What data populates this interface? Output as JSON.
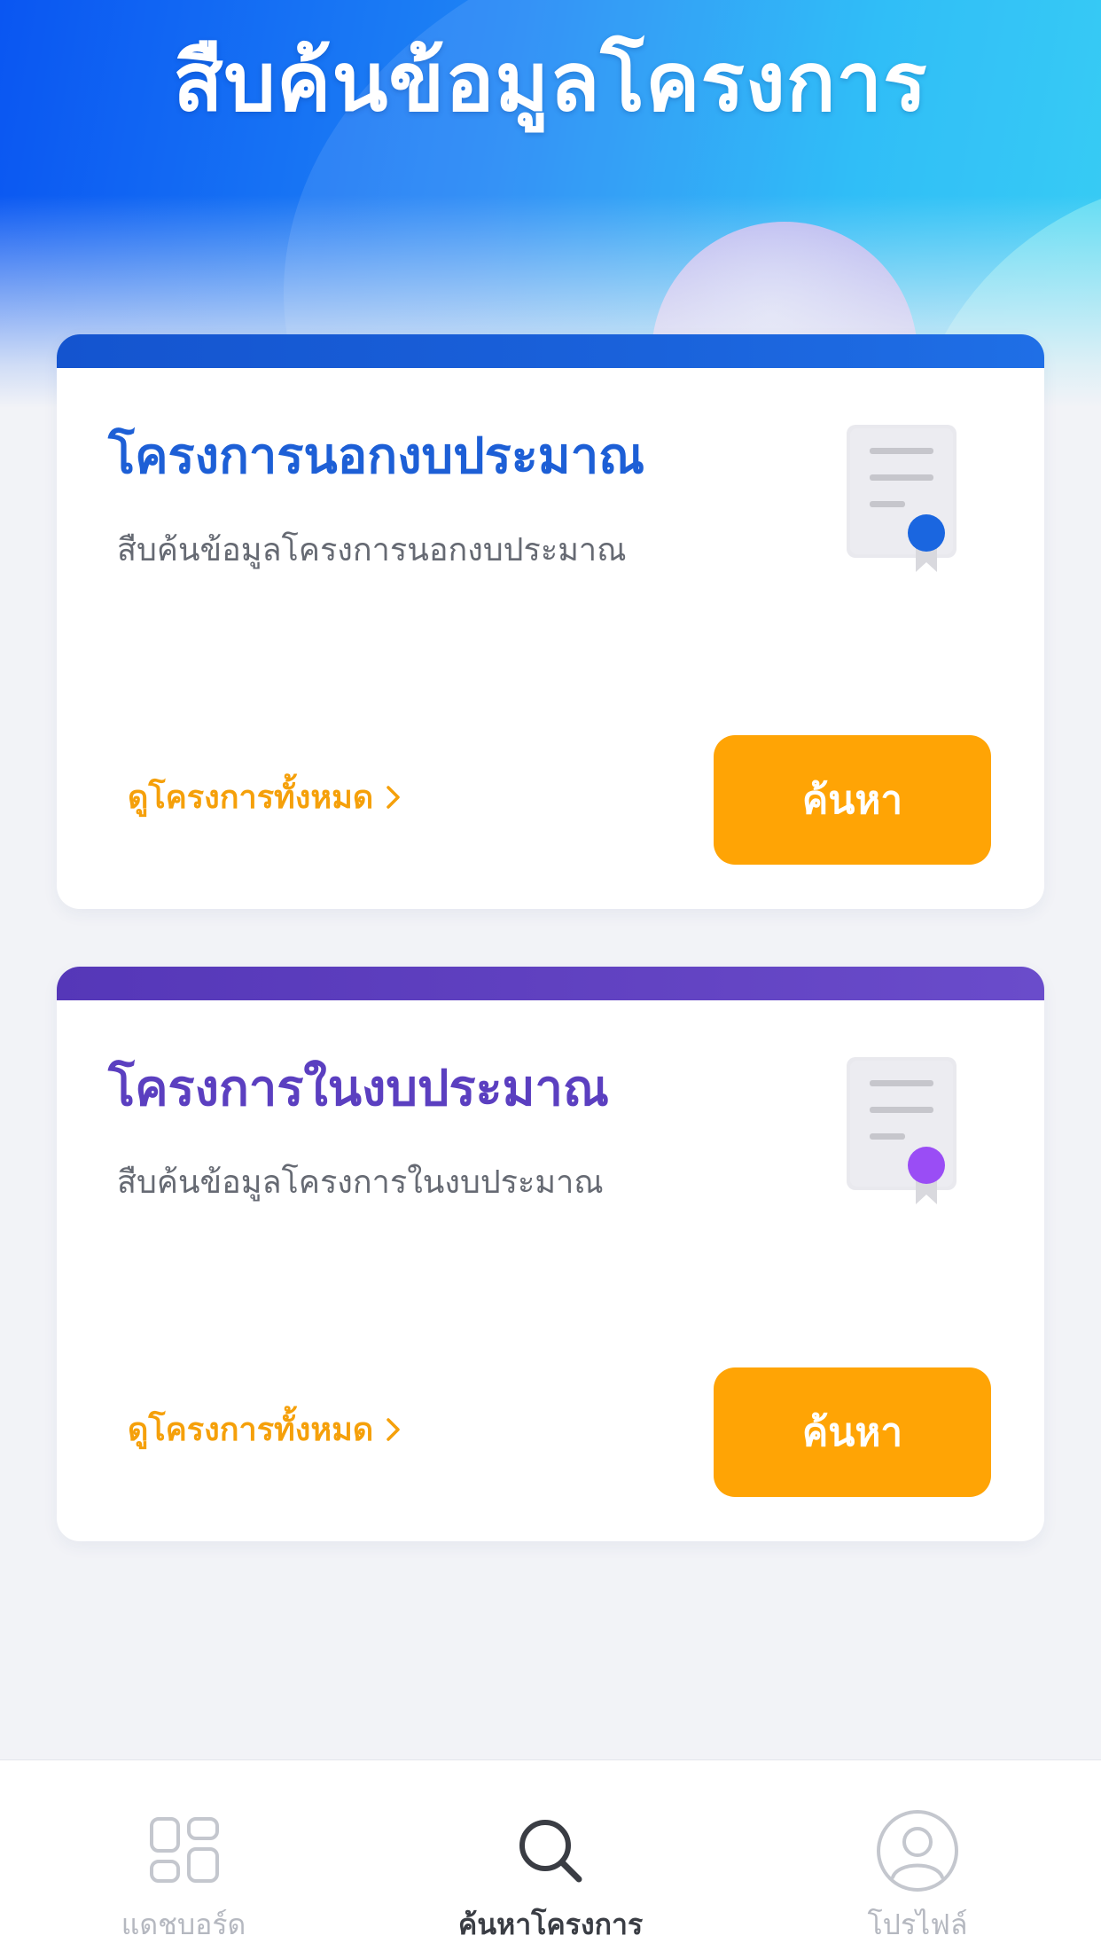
{
  "header": {
    "title": "สืบค้นข้อมูลโครงการ"
  },
  "cards": [
    {
      "title": "โครงการนอกงบประมาณ",
      "description": "สืบค้นข้อมูลโครงการนอกงบประมาณ",
      "view_all_label": "ดูโครงการทั้งหมด",
      "search_label": "ค้นหา",
      "icon": "certificate-icon",
      "accent_color": "#1d5fd6",
      "badge_color": "#1a66e0"
    },
    {
      "title": "โครงการในงบประมาณ",
      "description": "สืบค้นข้อมูลโครงการในงบประมาณ",
      "view_all_label": "ดูโครงการทั้งหมด",
      "search_label": "ค้นหา",
      "icon": "certificate-icon",
      "accent_color": "#5b3fc0",
      "badge_color": "#9a4df5"
    }
  ],
  "colors": {
    "primary_button": "#ffa405",
    "link": "#f5a00a"
  },
  "tabbar": {
    "items": [
      {
        "label": "แดชบอร์ด",
        "icon": "dashboard-icon",
        "active": false
      },
      {
        "label": "ค้นหาโครงการ",
        "icon": "search-icon",
        "active": true
      },
      {
        "label": "โปรไฟล์",
        "icon": "profile-icon",
        "active": false
      }
    ]
  }
}
